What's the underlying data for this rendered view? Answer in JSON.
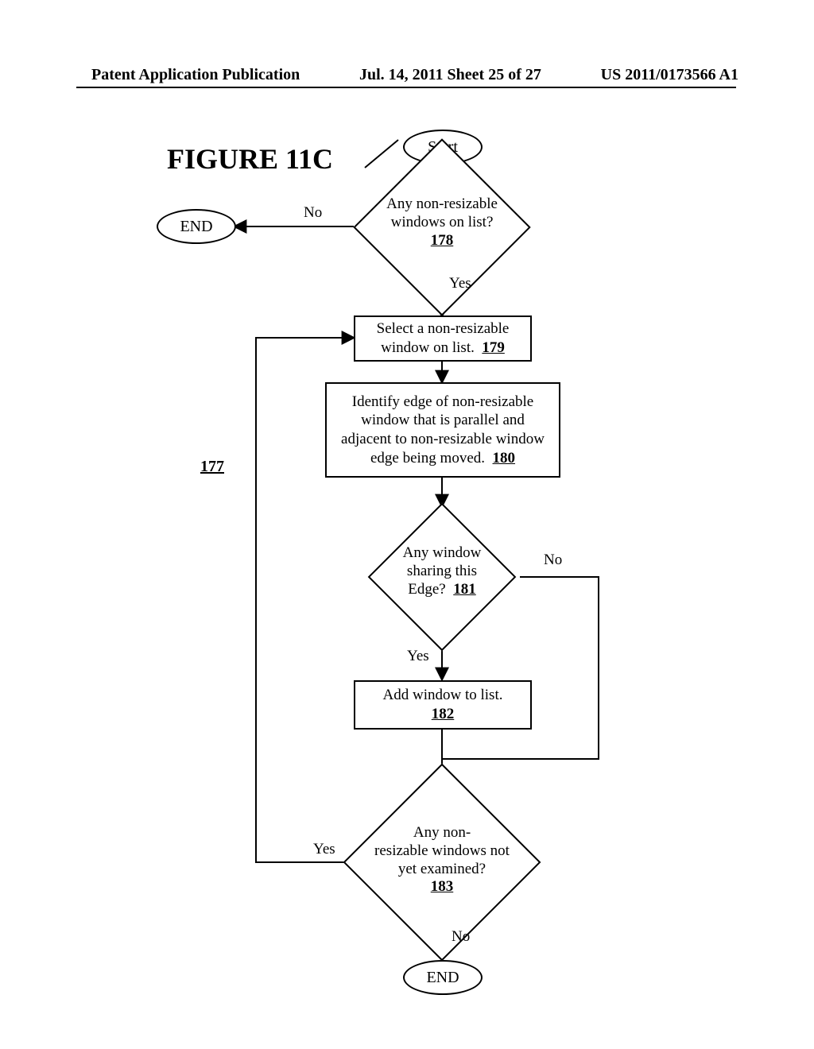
{
  "header": {
    "left": "Patent Application Publication",
    "center": "Jul. 14, 2011  Sheet 25 of 27",
    "right": "US 2011/0173566 A1"
  },
  "figure_title": "FIGURE 11C",
  "subref": "177",
  "nodes": {
    "start": "Start",
    "end_top": "END",
    "end_bottom": "END",
    "d178": {
      "l1": "Any non-resizable",
      "l2": "windows on list?",
      "ref": "178"
    },
    "p179": {
      "l1": "Select a non-resizable",
      "l2": "window on list.",
      "ref": "179"
    },
    "p180": {
      "l1": "Identify edge of non-resizable",
      "l2": "window that is parallel and",
      "l3": "adjacent to non-resizable window",
      "l4": "edge being moved.",
      "ref": "180"
    },
    "d181": {
      "l1": "Any window",
      "l2": "sharing this",
      "l3": "Edge?",
      "ref": "181"
    },
    "p182": {
      "l1": "Add window to list.",
      "ref": "182"
    },
    "d183": {
      "l1": "Any non-",
      "l2": "resizable windows not",
      "l3": "yet examined?",
      "ref": "183"
    }
  },
  "labels": {
    "no": "No",
    "yes": "Yes"
  }
}
